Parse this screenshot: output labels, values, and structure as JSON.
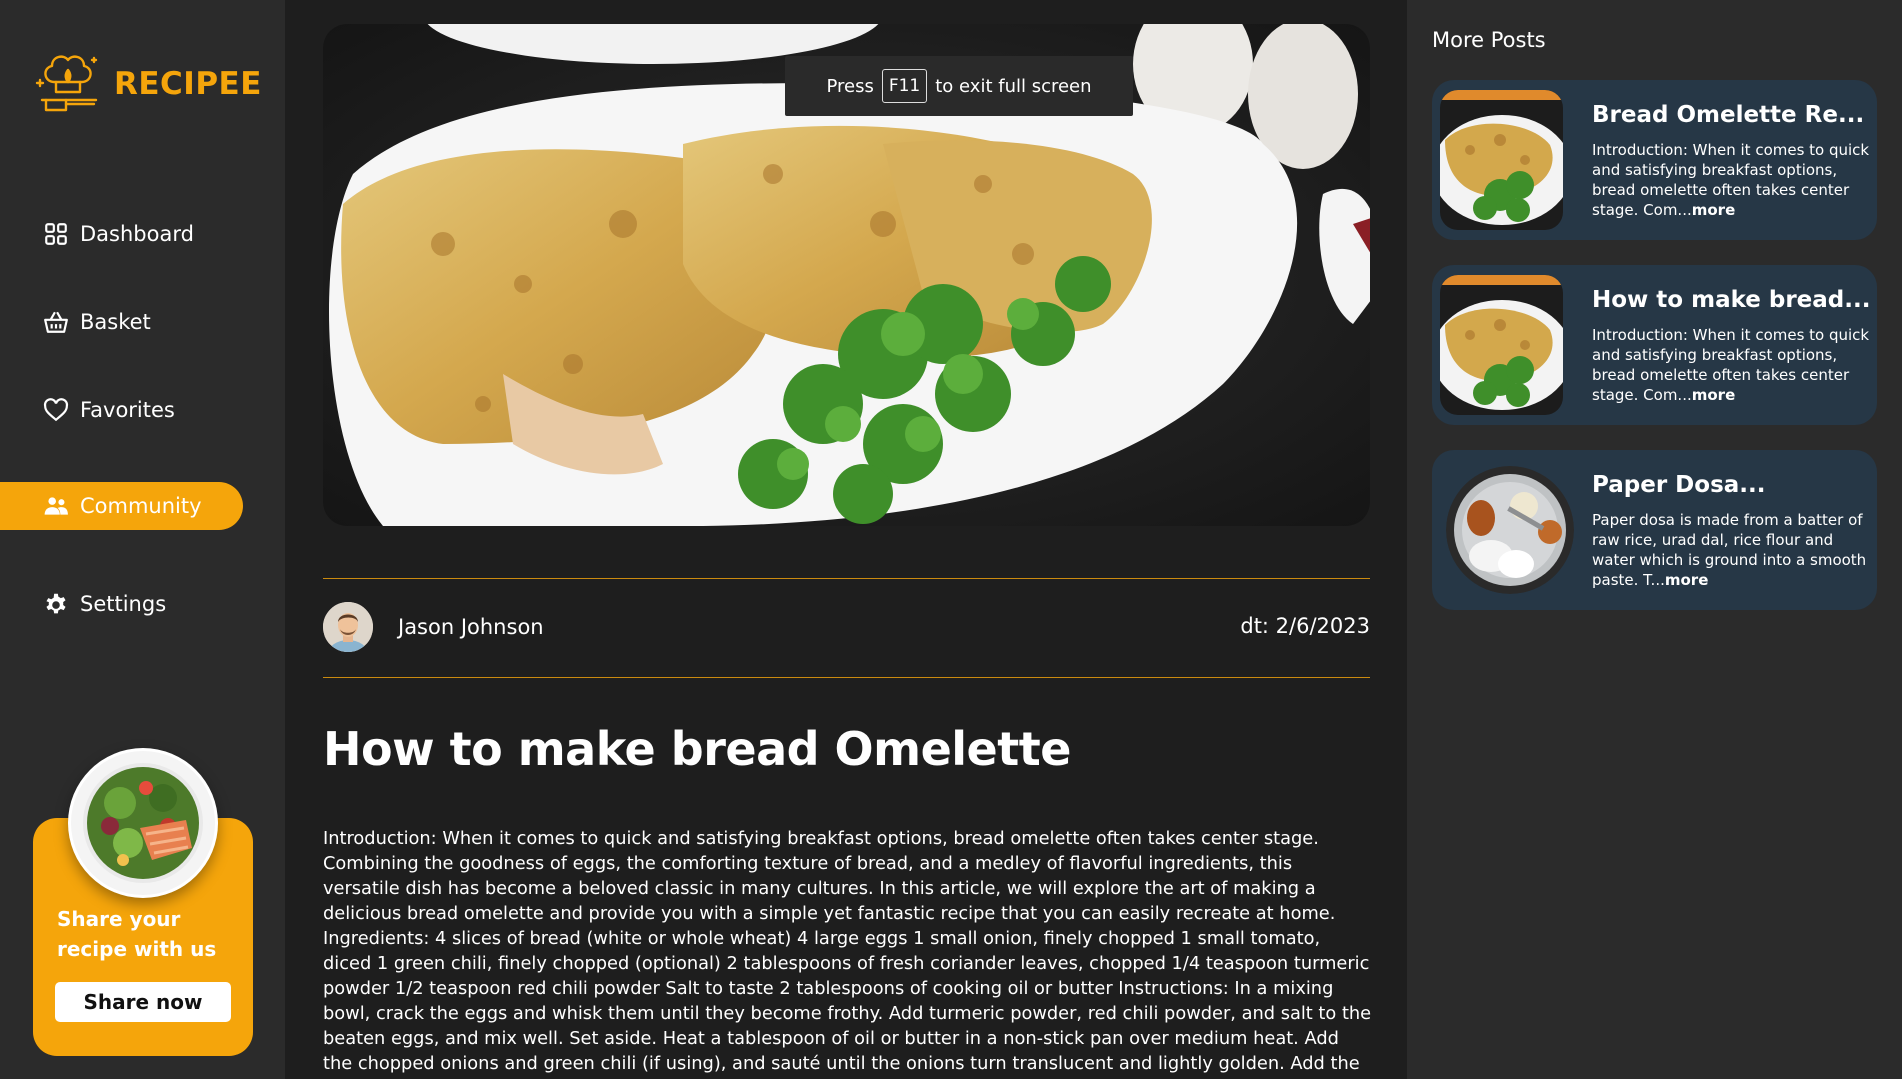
{
  "app": {
    "name": "RECIPEE"
  },
  "sidebar": {
    "items": [
      {
        "label": "Dashboard",
        "icon": "dashboard-icon"
      },
      {
        "label": "Basket",
        "icon": "basket-icon"
      },
      {
        "label": "Favorites",
        "icon": "heart-icon"
      },
      {
        "label": "Community",
        "icon": "community-icon",
        "active": true
      },
      {
        "label": "Settings",
        "icon": "gear-icon"
      }
    ],
    "share": {
      "text": "Share your recipe with us",
      "button": "Share now"
    }
  },
  "fullscreen_toast": {
    "prefix": "Press",
    "key": "F11",
    "suffix": "to exit full screen"
  },
  "post": {
    "author": "Jason Johnson",
    "date": "dt: 2/6/2023",
    "title": "How to make bread Omelette",
    "body": "Introduction: When it comes to quick and satisfying breakfast options, bread omelette often takes center stage. Combining the goodness of eggs, the comforting texture of bread, and a medley of flavorful ingredients, this versatile dish has become a beloved classic in many cultures. In this article, we will explore the art of making a delicious bread omelette and provide you with a simple yet fantastic recipe that you can easily recreate at home. Ingredients: 4 slices of bread (white or whole wheat) 4 large eggs 1 small onion, finely chopped 1 small tomato, diced 1 green chili, finely chopped (optional) 2 tablespoons of fresh coriander leaves, chopped 1/4 teaspoon turmeric powder 1/2 teaspoon red chili powder Salt to taste 2 tablespoons of cooking oil or butter Instructions: In a mixing bowl, crack the eggs and whisk them until they become frothy. Add turmeric powder, red chili powder, and salt to the beaten eggs, and mix well. Set aside. Heat a tablespoon of oil or butter in a non-stick pan over medium heat. Add the chopped onions and green chili (if using), and sauté until the onions turn translucent and lightly golden. Add the diced tomatoes to the pan and cook"
  },
  "more_posts": {
    "title": "More Posts",
    "cards": [
      {
        "title": "Bread Omelette Re...",
        "desc": "Introduction: When it comes to quick and satisfying breakfast options, bread omelette often takes center stage. Com...",
        "more": "more",
        "thumb": "omelette"
      },
      {
        "title": "How to make bread...",
        "desc": "Introduction: When it comes to quick and satisfying breakfast options, bread omelette often takes center stage. Com...",
        "more": "more",
        "thumb": "omelette"
      },
      {
        "title": "Paper Dosa...",
        "desc": "Paper dosa is made from a batter of raw rice, urad dal, rice flour and water which is ground into a smooth paste. T...",
        "more": "more",
        "thumb": "dosa"
      }
    ]
  },
  "colors": {
    "accent": "#f5a50b",
    "sidebar": "#2b2b2b",
    "card": "#263746",
    "main": "#1e1e1e"
  }
}
